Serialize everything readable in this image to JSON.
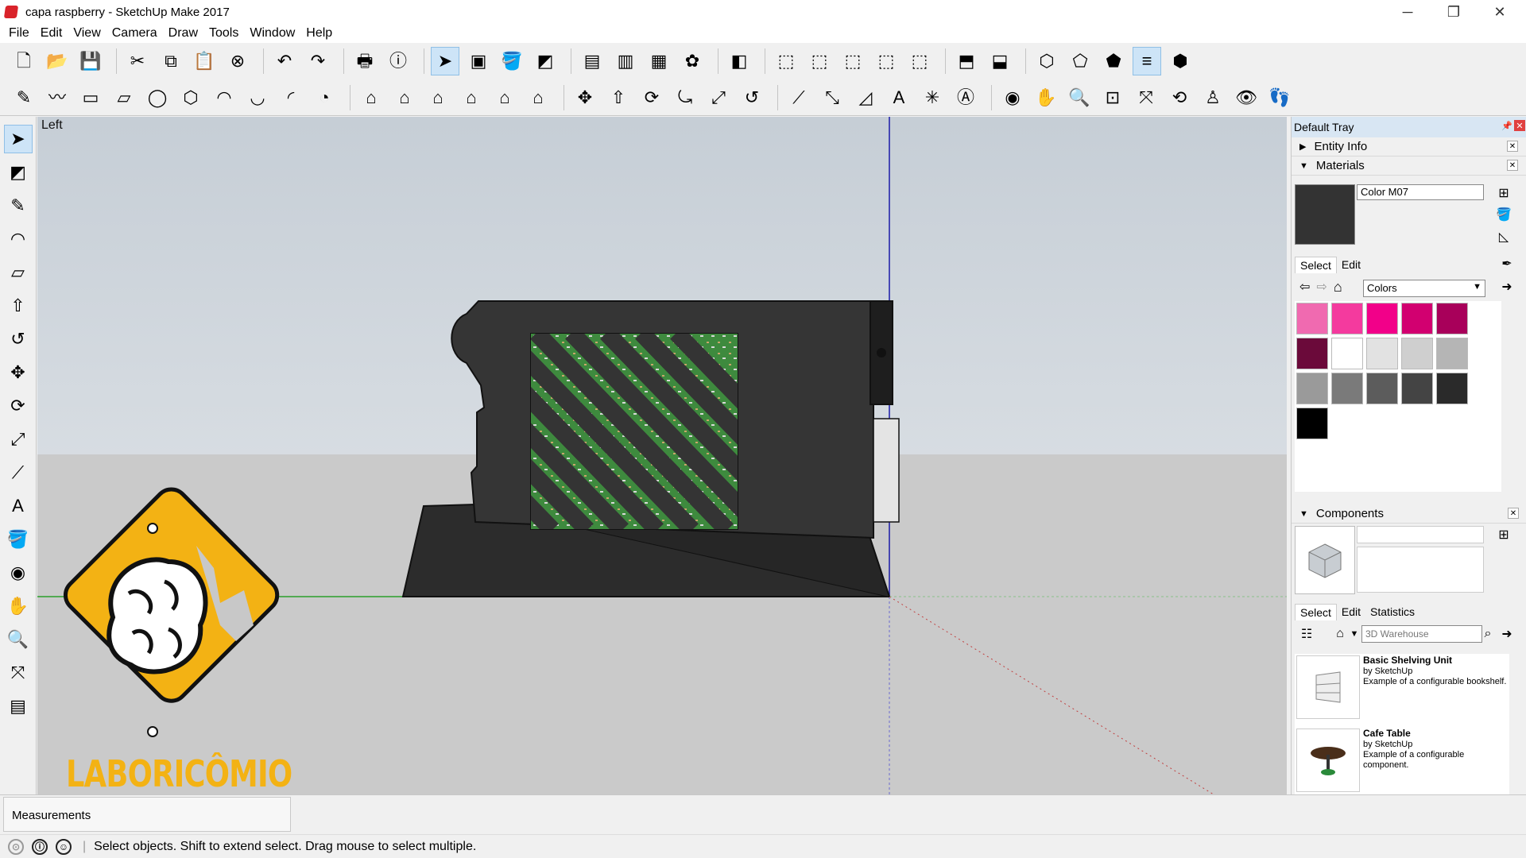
{
  "window": {
    "title": "capa raspberry - SketchUp Make 2017",
    "minimize": "─",
    "maximize": "❐",
    "close": "✕"
  },
  "menu": [
    "File",
    "Edit",
    "View",
    "Camera",
    "Draw",
    "Tools",
    "Window",
    "Help"
  ],
  "toolbar1": [
    {
      "name": "new-icon",
      "glyph": "🗋"
    },
    {
      "name": "open-icon",
      "glyph": "📂"
    },
    {
      "name": "save-icon",
      "glyph": "💾"
    },
    {
      "sep": true
    },
    {
      "name": "cut-icon",
      "glyph": "✂"
    },
    {
      "name": "copy-icon",
      "glyph": "⧉"
    },
    {
      "name": "paste-icon",
      "glyph": "📋"
    },
    {
      "name": "erase-icon",
      "glyph": "⊗"
    },
    {
      "sep": true
    },
    {
      "name": "undo-icon",
      "glyph": "↶"
    },
    {
      "name": "redo-icon",
      "glyph": "↷"
    },
    {
      "sep": true
    },
    {
      "name": "print-icon",
      "glyph": "🖶"
    },
    {
      "name": "model-info-icon",
      "glyph": "ⓘ"
    },
    {
      "sep": true
    },
    {
      "name": "select-icon",
      "glyph": "➤",
      "active": true
    },
    {
      "name": "make-component-icon",
      "glyph": "▣"
    },
    {
      "name": "paint-bucket-icon",
      "glyph": "🪣"
    },
    {
      "name": "eraser-icon",
      "glyph": "◩"
    },
    {
      "sep": true
    },
    {
      "name": "warehouse-icon",
      "glyph": "▤"
    },
    {
      "name": "share-model-icon",
      "glyph": "▥"
    },
    {
      "name": "share-component-icon",
      "glyph": "▦"
    },
    {
      "name": "extension-warehouse-icon",
      "glyph": "✿"
    },
    {
      "sep": true
    },
    {
      "name": "layers-icon",
      "glyph": "◧"
    },
    {
      "sep": true
    },
    {
      "name": "iso-view-icon",
      "glyph": "⬚"
    },
    {
      "name": "top-view-icon",
      "glyph": "⬚"
    },
    {
      "name": "front-view-icon",
      "glyph": "⬚"
    },
    {
      "name": "right-view-icon",
      "glyph": "⬚"
    },
    {
      "name": "back-view-icon",
      "glyph": "⬚"
    },
    {
      "sep": true
    },
    {
      "name": "xray-icon",
      "glyph": "⬒"
    },
    {
      "name": "back-edges-icon",
      "glyph": "⬓"
    },
    {
      "sep": true
    },
    {
      "name": "wireframe-icon",
      "glyph": "⬡"
    },
    {
      "name": "hidden-line-icon",
      "glyph": "⬠"
    },
    {
      "name": "shaded-icon",
      "glyph": "⬟"
    },
    {
      "name": "shaded-textures-icon",
      "glyph": "≡",
      "active": true
    },
    {
      "name": "monochrome-icon",
      "glyph": "⬢"
    }
  ],
  "toolbar2": [
    {
      "name": "pencil-icon",
      "glyph": "✎"
    },
    {
      "name": "freehand-icon",
      "glyph": "〰"
    },
    {
      "name": "rectangle-icon",
      "glyph": "▭"
    },
    {
      "name": "rotated-rectangle-icon",
      "glyph": "▱"
    },
    {
      "name": "circle-icon",
      "glyph": "◯"
    },
    {
      "name": "polygon-icon",
      "glyph": "⬡"
    },
    {
      "name": "arc-icon",
      "glyph": "◠"
    },
    {
      "name": "two-point-arc-icon",
      "glyph": "◡"
    },
    {
      "name": "three-point-arc-icon",
      "glyph": "◜"
    },
    {
      "name": "pie-icon",
      "glyph": "◔"
    },
    {
      "sep": true
    },
    {
      "name": "house-icon-1",
      "glyph": "⌂"
    },
    {
      "name": "house-icon-2",
      "glyph": "⌂"
    },
    {
      "name": "house-icon-3",
      "glyph": "⌂"
    },
    {
      "name": "house-icon-4",
      "glyph": "⌂"
    },
    {
      "name": "house-icon-5",
      "glyph": "⌂"
    },
    {
      "name": "house-icon-6",
      "glyph": "⌂"
    },
    {
      "sep": true
    },
    {
      "name": "move-icon",
      "glyph": "✥"
    },
    {
      "name": "push-pull-icon",
      "glyph": "⇧"
    },
    {
      "name": "rotate-icon",
      "glyph": "⟳"
    },
    {
      "name": "follow-me-icon",
      "glyph": "⤿"
    },
    {
      "name": "scale-icon",
      "glyph": "⤢"
    },
    {
      "name": "offset-icon",
      "glyph": "↺"
    },
    {
      "sep": true
    },
    {
      "name": "tape-measure-icon",
      "glyph": "⟋"
    },
    {
      "name": "dimension-icon",
      "glyph": "⤡"
    },
    {
      "name": "protractor-icon",
      "glyph": "◿"
    },
    {
      "name": "text-icon",
      "glyph": "A"
    },
    {
      "name": "axes-icon",
      "glyph": "✳"
    },
    {
      "name": "3d-text-icon",
      "glyph": "Ⓐ"
    },
    {
      "sep": true
    },
    {
      "name": "orbit-icon",
      "glyph": "◉"
    },
    {
      "name": "pan-icon",
      "glyph": "✋"
    },
    {
      "name": "zoom-icon",
      "glyph": "🔍"
    },
    {
      "name": "zoom-window-icon",
      "glyph": "⊡"
    },
    {
      "name": "zoom-extents-icon",
      "glyph": "⤧"
    },
    {
      "name": "previous-view-icon",
      "glyph": "⟲"
    },
    {
      "name": "position-camera-icon",
      "glyph": "♙"
    },
    {
      "name": "look-around-icon",
      "glyph": "👁"
    },
    {
      "name": "walk-icon",
      "glyph": "👣"
    }
  ],
  "lefttools": [
    {
      "name": "select-icon",
      "glyph": "➤",
      "active": true
    },
    {
      "name": "eraser-icon",
      "glyph": "◩"
    },
    {
      "name": "pencil-icon",
      "glyph": "✎"
    },
    {
      "name": "arc-icon",
      "glyph": "◠"
    },
    {
      "name": "rectangle-icon",
      "glyph": "▱"
    },
    {
      "name": "push-pull-icon",
      "glyph": "⇧"
    },
    {
      "name": "offset-icon",
      "glyph": "↺"
    },
    {
      "name": "move-icon",
      "glyph": "✥"
    },
    {
      "name": "rotate-icon",
      "glyph": "⟳"
    },
    {
      "name": "scale-icon",
      "glyph": "⤢"
    },
    {
      "name": "tape-measure-icon",
      "glyph": "⟋"
    },
    {
      "name": "text-icon",
      "glyph": "A"
    },
    {
      "name": "paint-bucket-icon",
      "glyph": "🪣"
    },
    {
      "name": "orbit-icon",
      "glyph": "◉"
    },
    {
      "name": "pan-icon",
      "glyph": "✋"
    },
    {
      "name": "zoom-icon",
      "glyph": "🔍"
    },
    {
      "name": "zoom-extents-icon",
      "glyph": "⤧"
    },
    {
      "name": "warehouse-icon",
      "glyph": "▤"
    }
  ],
  "viewport": {
    "view_label": "Left",
    "logo_text": "LABORICÔMIO"
  },
  "tray": {
    "title": "Default Tray",
    "entity_info": "Entity Info",
    "materials": {
      "title": "Materials",
      "current_material": "Color M07",
      "tab_select": "Select",
      "tab_edit": "Edit",
      "library": "Colors",
      "swatches": [
        "#f06ab0",
        "#f43a9e",
        "#f20089",
        "#d20070",
        "#a8005a",
        "#6b0a3a",
        "#ffffff",
        "#e2e2e2",
        "#cfcfcf",
        "#b5b5b5",
        "#9a9a9a",
        "#7a7a7a",
        "#5c5c5c",
        "#444444",
        "#2a2a2a",
        "#000000"
      ]
    },
    "components": {
      "title": "Components",
      "tab_select": "Select",
      "tab_edit": "Edit",
      "tab_statistics": "Statistics",
      "search_placeholder": "3D Warehouse",
      "items": [
        {
          "title": "Basic Shelving Unit",
          "author": "by SketchUp",
          "desc": "Example of a configurable bookshelf."
        },
        {
          "title": "Cafe Table",
          "author": "by SketchUp",
          "desc": "Example of a configurable component."
        }
      ]
    }
  },
  "measurements_label": "Measurements",
  "status_text": "Select objects. Shift to extend select. Drag mouse to select multiple."
}
